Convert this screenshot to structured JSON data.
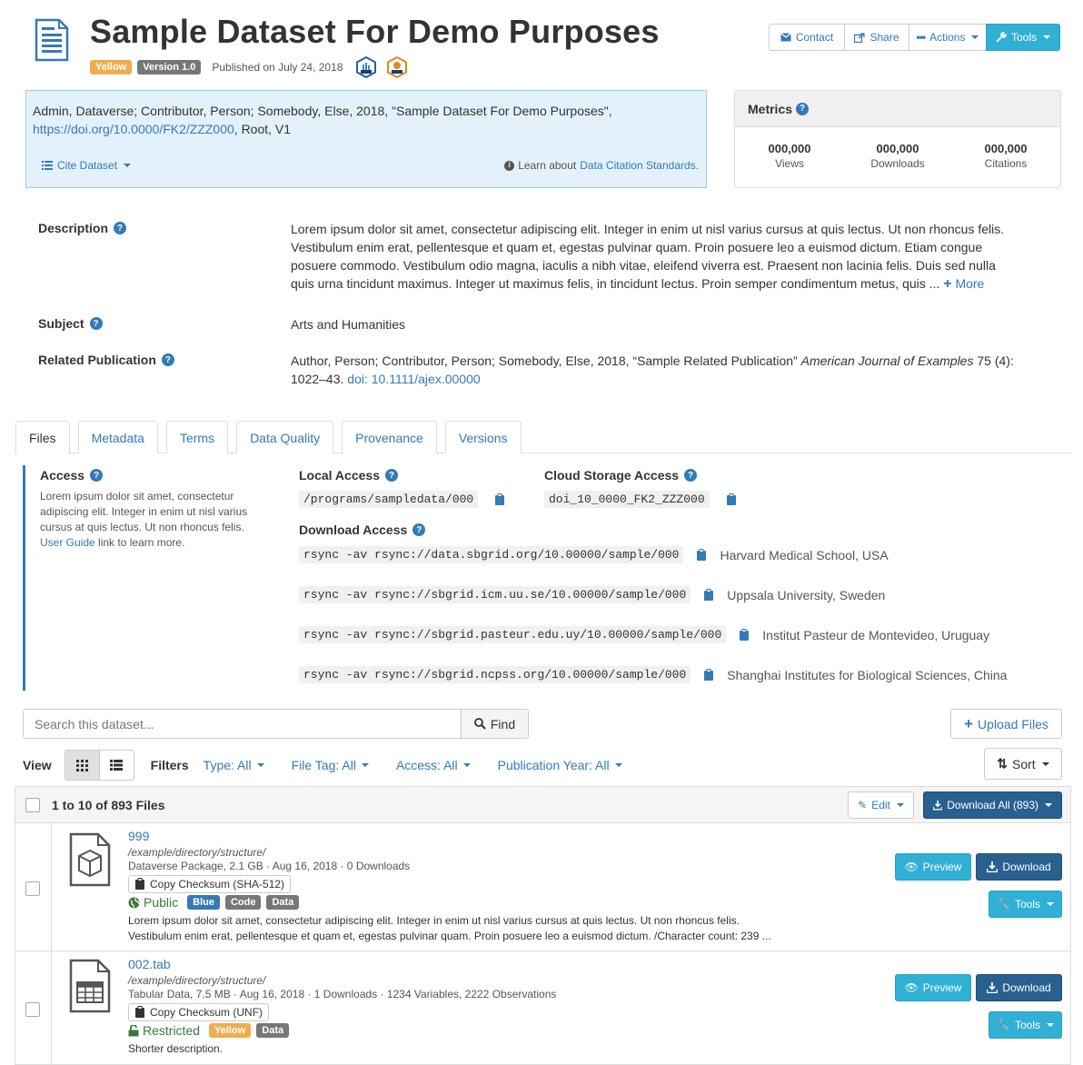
{
  "header": {
    "title": "Sample Dataset For Demo Purposes",
    "badges": {
      "status": "Yellow",
      "version": "Version 1.0"
    },
    "published": "Published on July 24, 2018",
    "buttons": {
      "contact": "Contact",
      "share": "Share",
      "actions": "Actions",
      "tools": "Tools"
    }
  },
  "citation": {
    "text": "Admin, Dataverse; Contributor, Person; Somebody, Else, 2018, \"Sample Dataset For Demo Purposes\",",
    "doi_link": "https://doi.org/10.0000/FK2/ZZZ000",
    "suffix": ", Root, V1",
    "cite_button": "Cite Dataset",
    "learn_text": "Learn about",
    "learn_link": "Data Citation Standards."
  },
  "metrics": {
    "title": "Metrics",
    "items": [
      {
        "value": "000,000",
        "label": "Views"
      },
      {
        "value": "000,000",
        "label": "Downloads"
      },
      {
        "value": "000,000",
        "label": "Citations"
      }
    ]
  },
  "metadata": {
    "description_label": "Description",
    "description": "Lorem ipsum dolor sit amet, consectetur adipiscing elit. Integer in enim ut nisl varius cursus at quis lectus. Ut non rhoncus felis. Vestibulum enim erat, pellentesque et quam et, egestas pulvinar quam. Proin posuere leo a euismod dictum. Etiam congue posuere commodo. Vestibulum odio magna, iaculis a nibh vitae, eleifend viverra est. Praesent non lacinia felis. Duis sed nulla quis urna tincidunt maximus. Integer ut maximus felis, in tincidunt lectus. Proin semper condimentum metus, quis ...",
    "more": "More",
    "subject_label": "Subject",
    "subject": "Arts and Humanities",
    "publication_label": "Related Publication",
    "publication_text": "Author, Person; Contributor, Person; Somebody, Else, 2018, “Sample Related Publication”",
    "publication_journal": "American Journal of Examples",
    "publication_issue": "75 (4): 1022–43.",
    "publication_doi": "doi: 10.1111/ajex.00000"
  },
  "tabs": [
    "Files",
    "Metadata",
    "Terms",
    "Data Quality",
    "Provenance",
    "Versions"
  ],
  "access": {
    "title": "Access",
    "desc": "Lorem ipsum dolor sit amet, consectetur adipiscing elit. Integer in enim ut nisl varius cursus at quis lectus. Ut non rhoncus felis.",
    "guide_link": "User Guide",
    "guide_suffix": "link to learn more.",
    "local_title": "Local Access",
    "local_path": "/programs/sampledata/000",
    "cloud_title": "Cloud Storage Access",
    "cloud_path": "doi_10_0000_FK2_ZZZ000",
    "download_title": "Download Access",
    "mirrors": [
      {
        "cmd": "rsync -av rsync://data.sbgrid.org/10.00000/sample/000",
        "site": "Harvard Medical School, USA"
      },
      {
        "cmd": "rsync -av rsync://sbgrid.icm.uu.se/10.00000/sample/000",
        "site": "Uppsala University, Sweden"
      },
      {
        "cmd": "rsync -av rsync://sbgrid.pasteur.edu.uy/10.00000/sample/000",
        "site": "Institut Pasteur de Montevideo, Uruguay"
      },
      {
        "cmd": "rsync -av rsync://sbgrid.ncpss.org/10.00000/sample/000",
        "site": "Shanghai Institutes for Biological Sciences, China"
      }
    ]
  },
  "toolbar": {
    "search_placeholder": "Search this dataset...",
    "find": "Find",
    "upload": "Upload Files",
    "view_label": "View",
    "filters_label": "Filters",
    "filters": [
      "Type: All",
      "File Tag: All",
      "Access: All",
      "Publication Year: All"
    ],
    "sort": "Sort"
  },
  "files": {
    "count_label": "1 to 10 of 893 Files",
    "edit": "Edit",
    "download_all": "Download All (893)",
    "rows": [
      {
        "name": "999",
        "path": "/example/directory/structure/",
        "info": "Dataverse Package, 2.1 GB · Aug 16, 2018 · 0 Downloads",
        "checksum": "Copy Checksum (SHA-512)",
        "access": "Public",
        "tags": [
          "Blue",
          "Code",
          "Data"
        ],
        "desc": "Lorem ipsum dolor sit amet, consectetur adipiscing elit. Integer in enim ut nisl varius cursus at quis lectus. Ut non rhoncus felis. Vestibulum enim erat, pellentesque et quam et, egestas pulvinar quam. Proin posuere leo a euismod dictum. /Character count: 239 ...",
        "preview": "Preview",
        "download": "Download",
        "tools": "Tools"
      },
      {
        "name": "002.tab",
        "path": "/example/directory/structure/",
        "info": "Tabular Data, 7.5 MB · Aug 16, 2018 · 1 Downloads · 1234 Variables, 2222 Observations",
        "checksum": "Copy Checksum (UNF)",
        "access": "Restricted",
        "tags": [
          "Yellow",
          "Data"
        ],
        "desc": "Shorter description.",
        "preview": "Preview",
        "download": "Download",
        "tools": "Tools"
      }
    ]
  },
  "colors": {
    "link": "#337ab7",
    "info": "#31b0d5",
    "primary": "#286090",
    "public": "#3c763d",
    "yellow": "#f0ad4e"
  }
}
